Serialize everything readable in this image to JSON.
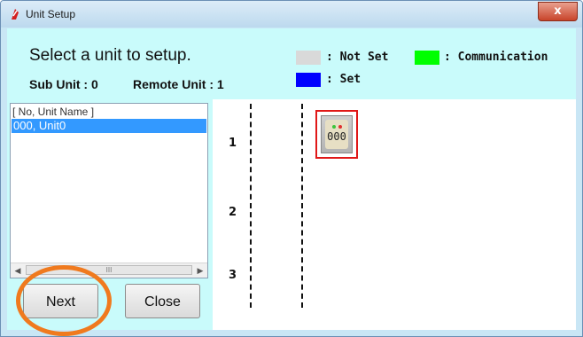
{
  "window": {
    "title": "Unit Setup",
    "close_glyph": "x"
  },
  "header": {
    "instruction": "Select a unit to setup.",
    "sub_unit_label": "Sub Unit : 0",
    "remote_unit_label": "Remote Unit : 1"
  },
  "legend": [
    {
      "label": ": Not Set",
      "color": "#d9d9d9"
    },
    {
      "label": ": Communication",
      "color": "#00ff00"
    },
    {
      "label": ": Set",
      "color": "#0000ff"
    }
  ],
  "unit_list": {
    "header": "[ No, Unit Name ]",
    "items": [
      "000, Unit0"
    ],
    "selected_index": 0,
    "scroll_thumb_glyph": "III"
  },
  "buttons": {
    "next": "Next",
    "close": "Close"
  },
  "slots": [
    "1",
    "2",
    "3"
  ],
  "units": [
    {
      "id": "000",
      "slot": 1,
      "selected": true
    }
  ],
  "colors": {
    "header_bg": "#c9fbfb",
    "selection": "#3399ff",
    "highlight_ring": "#f07a1e",
    "unit_border": "#e01818"
  },
  "icons": {
    "app": "app-logo-icon",
    "close": "close-icon",
    "scroll_left": "chevron-left-icon",
    "scroll_right": "chevron-right-icon"
  }
}
